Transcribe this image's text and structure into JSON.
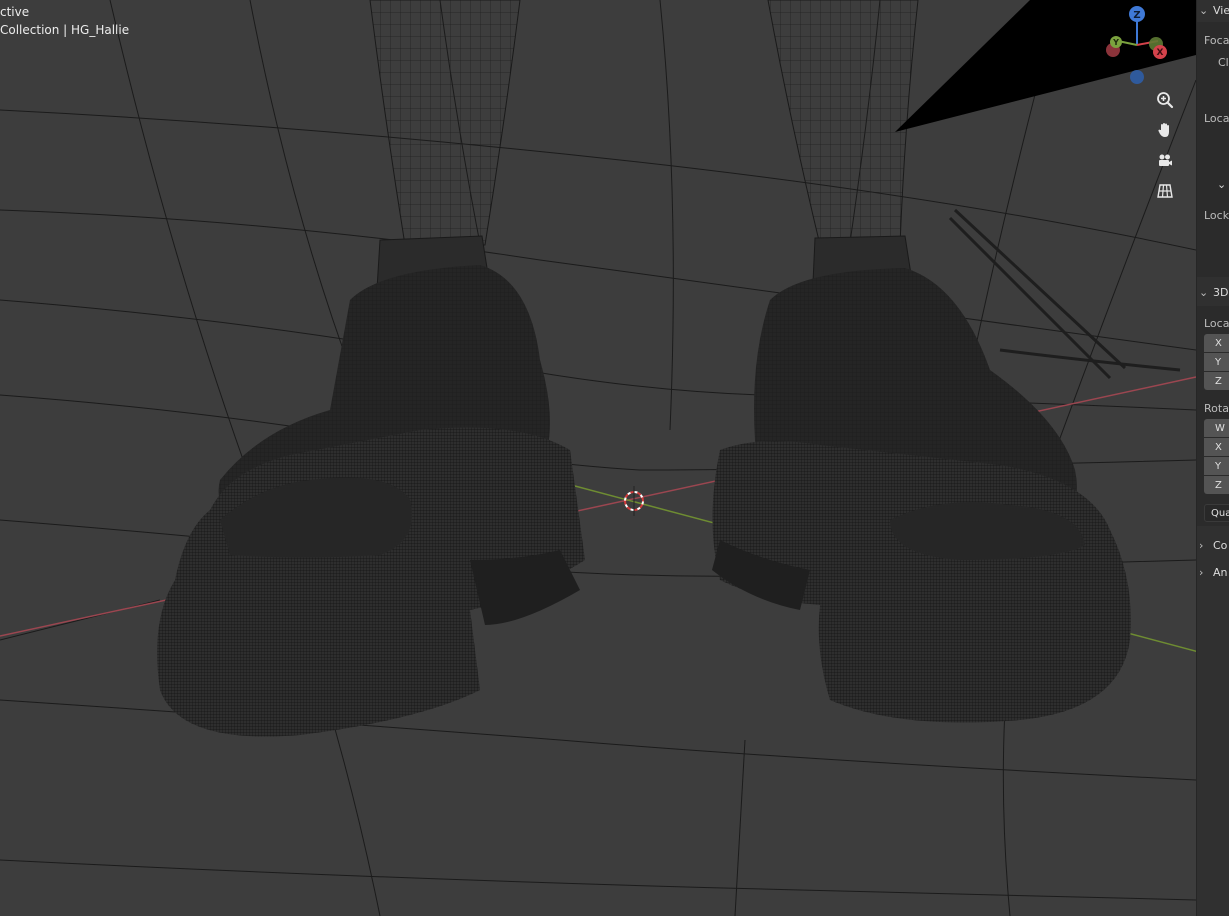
{
  "viewport": {
    "mode_text": "ctive",
    "collection_text": "Collection | HG_Hallie"
  },
  "gizmo": {
    "z_label": "Z",
    "y_label": "Y",
    "x_label": "X",
    "colors": {
      "z": "#3f79d6",
      "y": "#7ba23e",
      "x": "#d4424b"
    }
  },
  "nav_buttons": [
    {
      "icon": "zoom-icon"
    },
    {
      "icon": "pan-hand-icon"
    },
    {
      "icon": "camera-icon"
    },
    {
      "icon": "ortho-grid-icon"
    }
  ],
  "sidebar": {
    "view_panel": {
      "title": "Vie",
      "focal_label": "Focal",
      "clip_label": "Cl",
      "local_label": "Loca",
      "lock_label": "Lock"
    },
    "cursor_panel": {
      "title": "3D",
      "location_label": "Loca",
      "loc_fields": [
        "X",
        "Y",
        "Z"
      ],
      "rotation_label": "Rotat",
      "rot_fields": [
        "W",
        "X",
        "Y",
        "Z"
      ],
      "mode_value": "Qua"
    },
    "sub_panels": [
      "Co",
      "An"
    ]
  },
  "colors": {
    "viewport_bg": "#3d3d3d",
    "floor_line": "#1a1a1a",
    "x_axis": "#9b4650",
    "y_axis": "#6e8c32"
  }
}
